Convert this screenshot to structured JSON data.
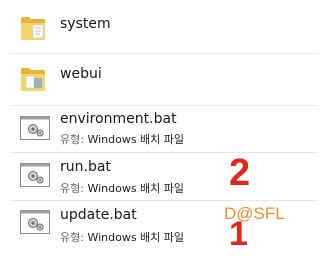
{
  "files": [
    {
      "name": "system",
      "type": "folder"
    },
    {
      "name": "webui",
      "type": "folder"
    },
    {
      "name": "environment.bat",
      "type": "batch",
      "type_label": "유형:",
      "type_value": "Windows 배치 파일"
    },
    {
      "name": "run.bat",
      "type": "batch",
      "type_label": "유형:",
      "type_value": "Windows 배치 파일"
    },
    {
      "name": "update.bat",
      "type": "batch",
      "type_label": "유형:",
      "type_value": "Windows 배치 파일"
    }
  ],
  "annotations": {
    "step_two": "2",
    "step_one": "1",
    "watermark": "D@SFL"
  },
  "colors": {
    "annotation_red": "#e0291c",
    "watermark_orange": "#f0902a",
    "folder_yellow": "#f5c542"
  }
}
